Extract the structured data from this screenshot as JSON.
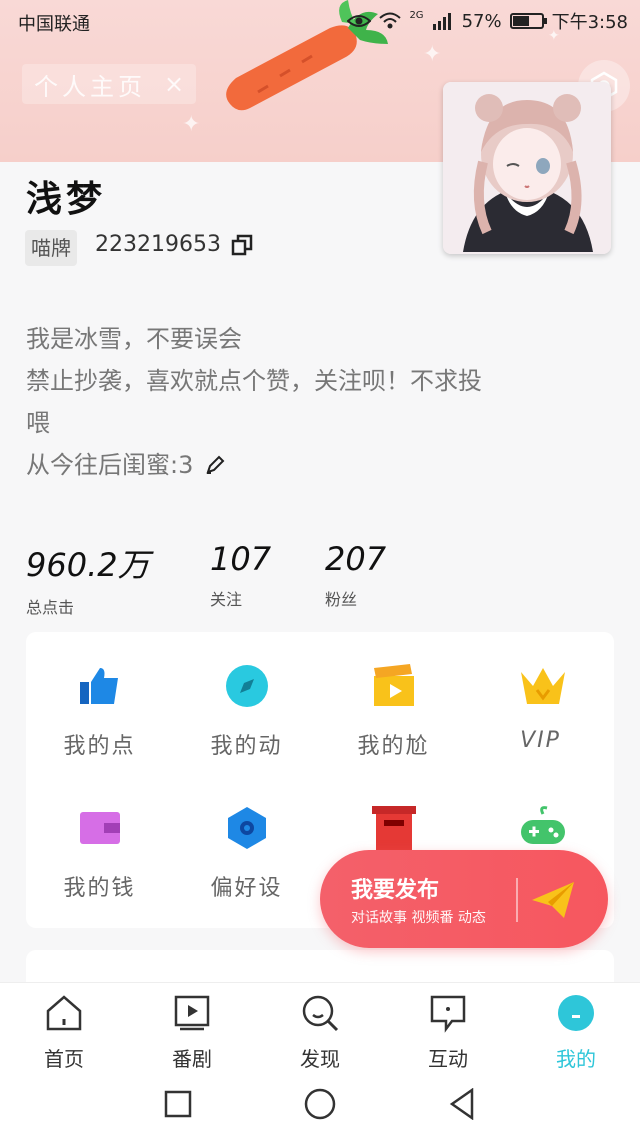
{
  "status_bar": {
    "carrier": "中国联通",
    "network": "2G",
    "battery": "57%",
    "battery_level": 0.57,
    "time": "下午3:58"
  },
  "header": {
    "page_chip": "个人主页",
    "close_symbol": "×"
  },
  "profile": {
    "name": "浅梦",
    "badge": "喵牌",
    "uid": "223219653",
    "bio": [
      "我是冰雪，不要误会",
      "禁止抄袭，喜欢就点个赞，关注呗！不求投",
      "喂",
      "从今往后闺蜜:3"
    ]
  },
  "stats": [
    {
      "value": "960.2万",
      "label": "总点击"
    },
    {
      "value": "107",
      "label": "关注"
    },
    {
      "value": "207",
      "label": "粉丝"
    }
  ],
  "tools": [
    {
      "label": "我的点",
      "icon": "thumbs-up-icon",
      "color": "#1e88e5"
    },
    {
      "label": "我的动",
      "icon": "compass-icon",
      "color": "#29c9e0"
    },
    {
      "label": "我的尬",
      "icon": "clapperboard-icon",
      "color": "#f9c21a"
    },
    {
      "label": "VIP",
      "icon": "crown-icon",
      "color": "#f9c21a"
    },
    {
      "label": "我的钱",
      "icon": "wallet-icon",
      "color": "#d66ee6"
    },
    {
      "label": "偏好设",
      "icon": "hexagon-settings-icon",
      "color": "#1e88e5"
    },
    {
      "label": "",
      "icon": "mailbox-icon",
      "color": "#e53935"
    },
    {
      "label": "",
      "icon": "gamepad-icon",
      "color": "#43c46b"
    }
  ],
  "fab": {
    "title": "我要发布",
    "subtitle": "对话故事 视频番 动态"
  },
  "tabs": [
    {
      "label": "首页",
      "icon": "home-icon"
    },
    {
      "label": "番剧",
      "icon": "play-screen-icon"
    },
    {
      "label": "发现",
      "icon": "discover-search-icon"
    },
    {
      "label": "互动",
      "icon": "message-icon"
    },
    {
      "label": "我的",
      "icon": "profile-icon",
      "active": true
    }
  ],
  "colors": {
    "accent": "#2ec6d9",
    "fab": "#f4606a",
    "banner": "#f8d6d2"
  }
}
